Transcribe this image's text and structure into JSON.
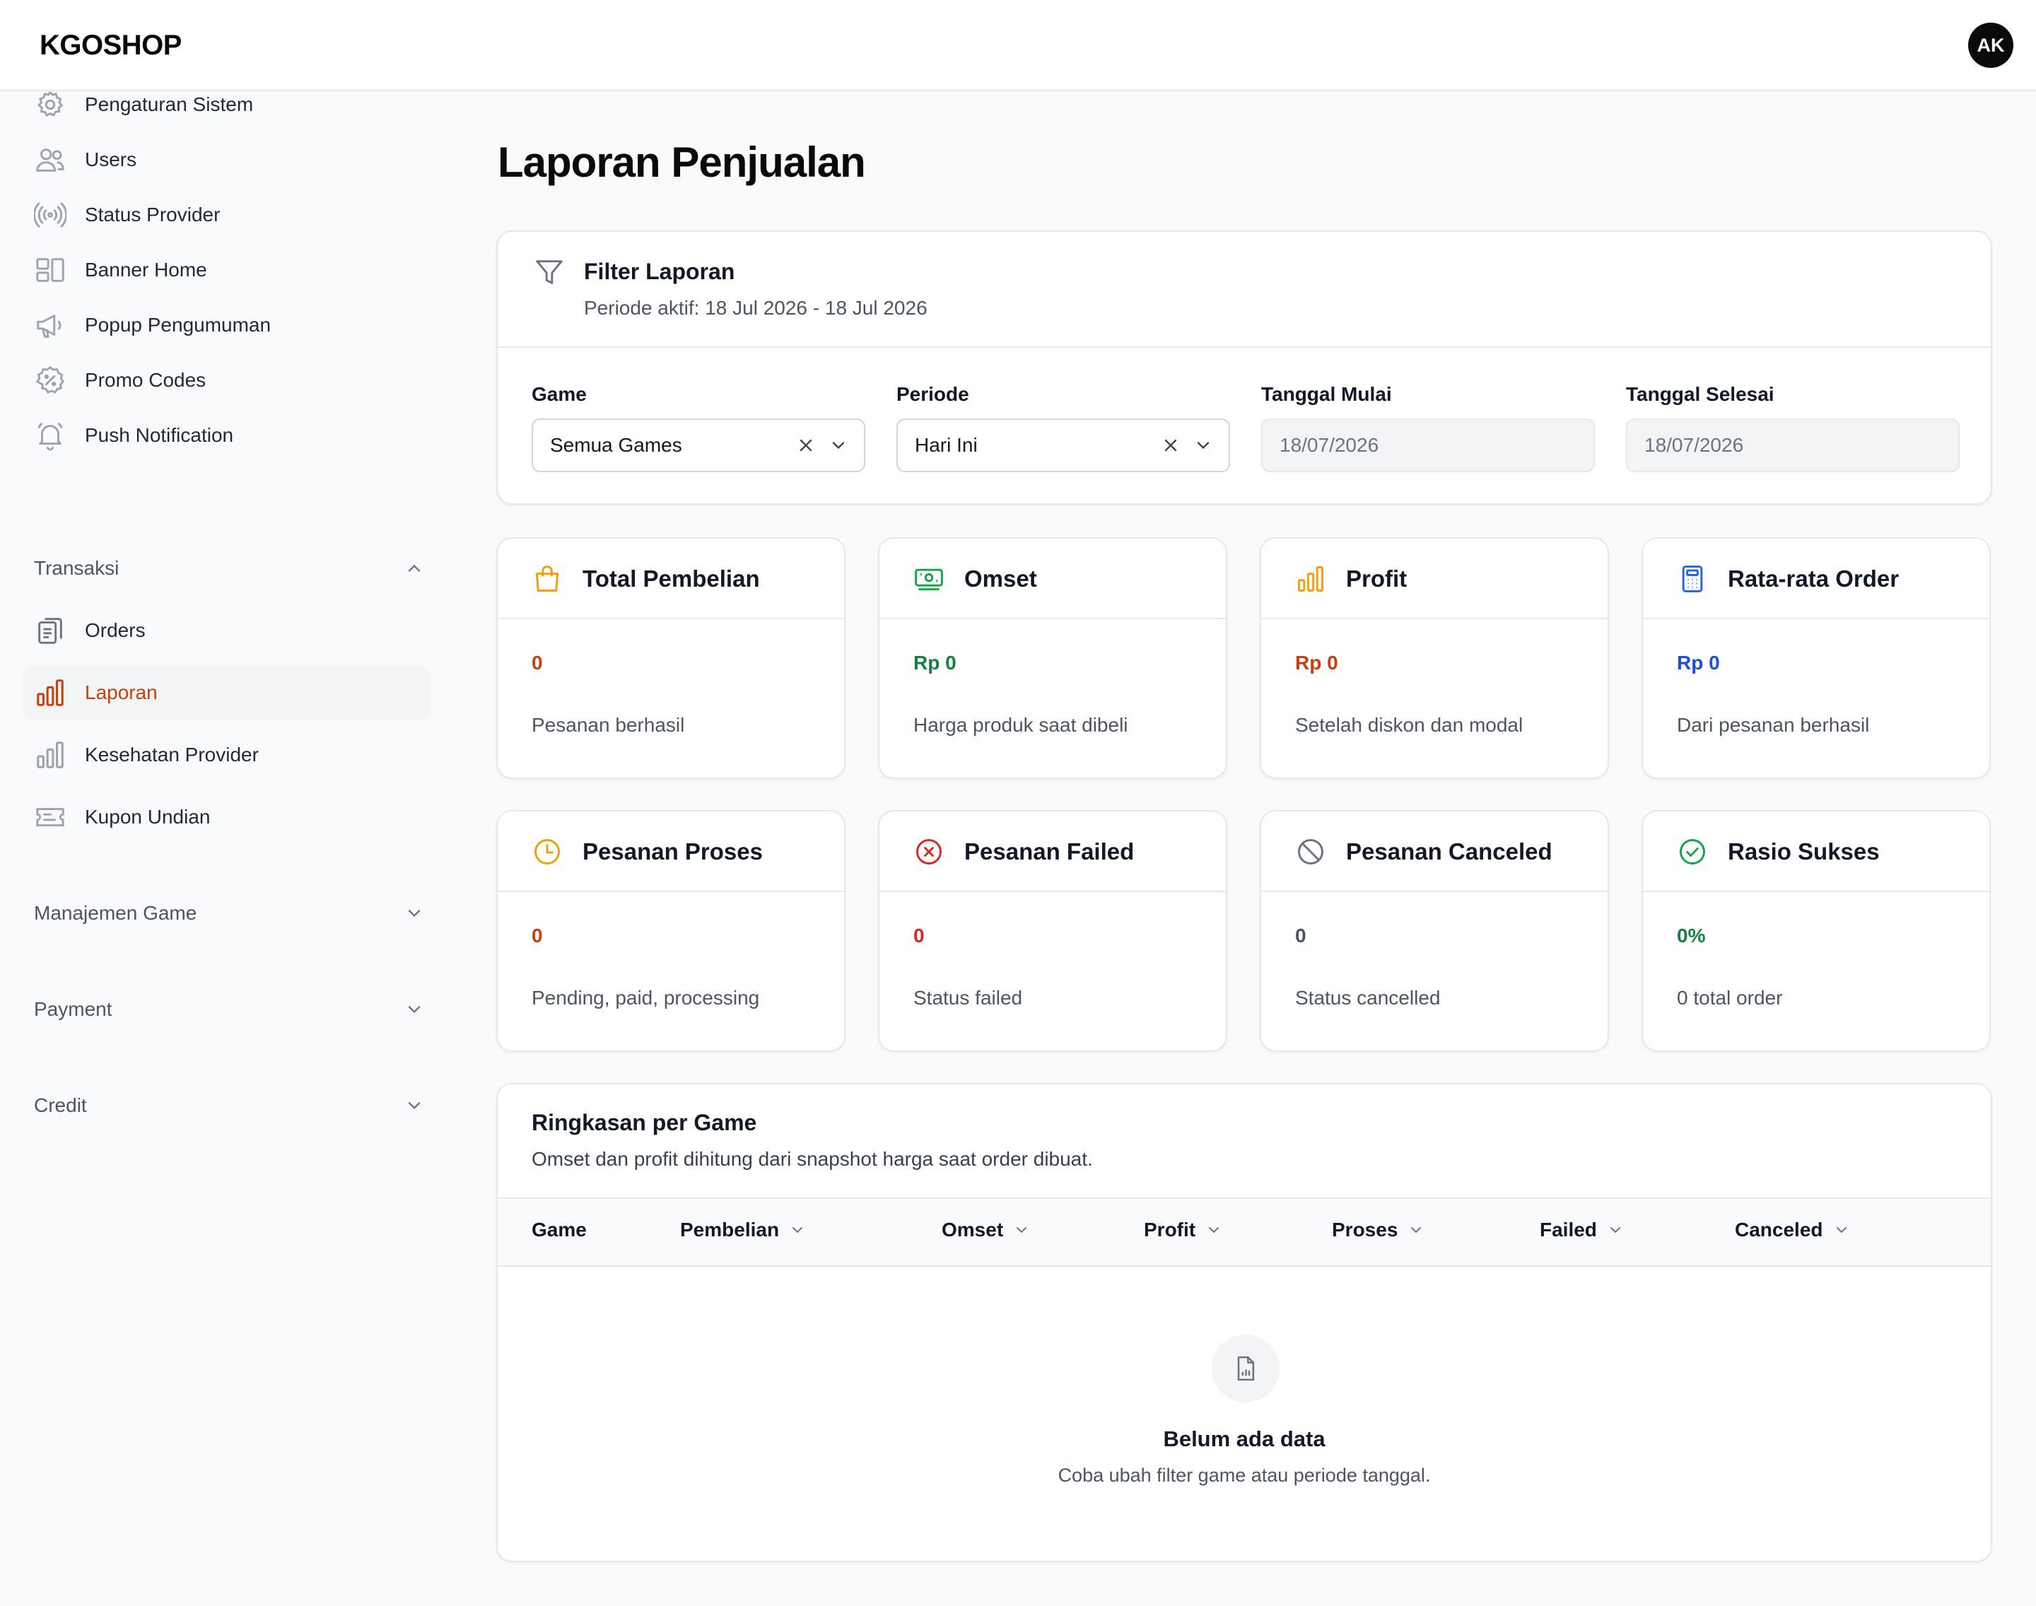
{
  "header": {
    "logo": "KGOSHOP",
    "avatar_initials": "AK"
  },
  "sidebar": {
    "items_top": [
      {
        "label": "Pengaturan Sistem",
        "icon": "gear-icon"
      },
      {
        "label": "Users",
        "icon": "users-icon"
      },
      {
        "label": "Status Provider",
        "icon": "signal-icon"
      },
      {
        "label": "Banner Home",
        "icon": "layout-icon"
      },
      {
        "label": "Popup Pengumuman",
        "icon": "megaphone-icon"
      },
      {
        "label": "Promo Codes",
        "icon": "percent-badge-icon"
      },
      {
        "label": "Push Notification",
        "icon": "bell-icon"
      }
    ],
    "section_transaksi": "Transaksi",
    "items_transaksi": [
      {
        "label": "Orders",
        "icon": "clipboard-icon"
      },
      {
        "label": "Laporan",
        "icon": "bar-chart-icon",
        "active": true
      },
      {
        "label": "Kesehatan Provider",
        "icon": "bar-chart-icon"
      },
      {
        "label": "Kupon Undian",
        "icon": "ticket-icon"
      }
    ],
    "section_manajemen": "Manajemen Game",
    "section_payment": "Payment",
    "section_credit": "Credit"
  },
  "main": {
    "title": "Laporan Penjualan",
    "filter": {
      "title": "Filter Laporan",
      "subtitle": "Periode aktif: 18 Jul 2026 - 18 Jul 2026",
      "game_label": "Game",
      "game_value": "Semua Games",
      "periode_label": "Periode",
      "periode_value": "Hari Ini",
      "start_label": "Tanggal Mulai",
      "start_value": "18/07/2026",
      "end_label": "Tanggal Selesai",
      "end_value": "18/07/2026"
    },
    "stats": [
      {
        "title": "Total Pembelian",
        "value": "0",
        "desc": "Pesanan berhasil",
        "icon": "shopping-bag-icon",
        "color": "#c2410c"
      },
      {
        "title": "Omset",
        "value": "Rp 0",
        "desc": "Harga produk saat dibeli",
        "icon": "banknote-icon",
        "color": "#15803d"
      },
      {
        "title": "Profit",
        "value": "Rp 0",
        "desc": "Setelah diskon dan modal",
        "icon": "bar-chart-icon",
        "color": "#c2410c"
      },
      {
        "title": "Rata-rata Order",
        "value": "Rp 0",
        "desc": "Dari pesanan berhasil",
        "icon": "calculator-icon",
        "color": "#1d4ed8"
      },
      {
        "title": "Pesanan Proses",
        "value": "0",
        "desc": "Pending, paid, processing",
        "icon": "clock-icon",
        "color": "#c2410c"
      },
      {
        "title": "Pesanan Failed",
        "value": "0",
        "desc": "Status failed",
        "icon": "x-circle-icon",
        "color": "#dc2626"
      },
      {
        "title": "Pesanan Canceled",
        "value": "0",
        "desc": "Status cancelled",
        "icon": "ban-icon",
        "color": "#4b5563"
      },
      {
        "title": "Rasio Sukses",
        "value": "0%",
        "desc": "0 total order",
        "icon": "check-circle-icon",
        "color": "#15803d"
      }
    ],
    "summary": {
      "title": "Ringkasan per Game",
      "subtitle": "Omset dan profit dihitung dari snapshot harga saat order dibuat.",
      "columns": [
        "Game",
        "Pembelian",
        "Omset",
        "Profit",
        "Proses",
        "Failed",
        "Canceled"
      ],
      "empty_title": "Belum ada data",
      "empty_subtitle": "Coba ubah filter game atau periode tanggal."
    }
  }
}
